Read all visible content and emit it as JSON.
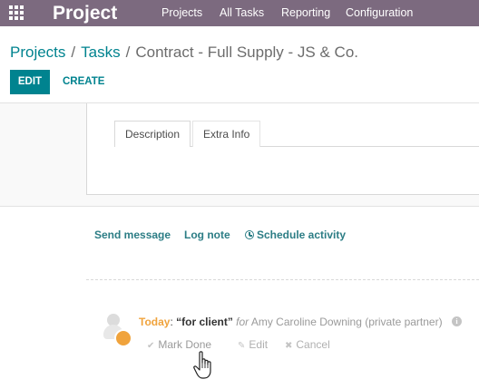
{
  "navbar": {
    "brand": "Project",
    "menu": [
      "Projects",
      "All Tasks",
      "Reporting",
      "Configuration"
    ]
  },
  "breadcrumb": {
    "items": [
      "Projects",
      "Tasks"
    ],
    "separator": "/",
    "current": "Contract - Full Supply - JS & Co."
  },
  "control_panel": {
    "edit_label": "EDIT",
    "create_label": "CREATE"
  },
  "form": {
    "tabs": [
      "Description",
      "Extra Info"
    ],
    "active_tab": "Description"
  },
  "chatter": {
    "send_message": "Send message",
    "log_note": "Log note",
    "schedule_activity": "Schedule activity"
  },
  "activity": {
    "when": "Today",
    "colon": ":",
    "summary": "“for client”",
    "for_label": "for",
    "assignee": "Amy Caroline Downing (private partner)",
    "mark_done": "Mark Done",
    "edit": "Edit",
    "cancel": "Cancel"
  },
  "colors": {
    "navbar": "#7c6a7f",
    "primary": "#00838f",
    "today": "#f0a33c"
  }
}
